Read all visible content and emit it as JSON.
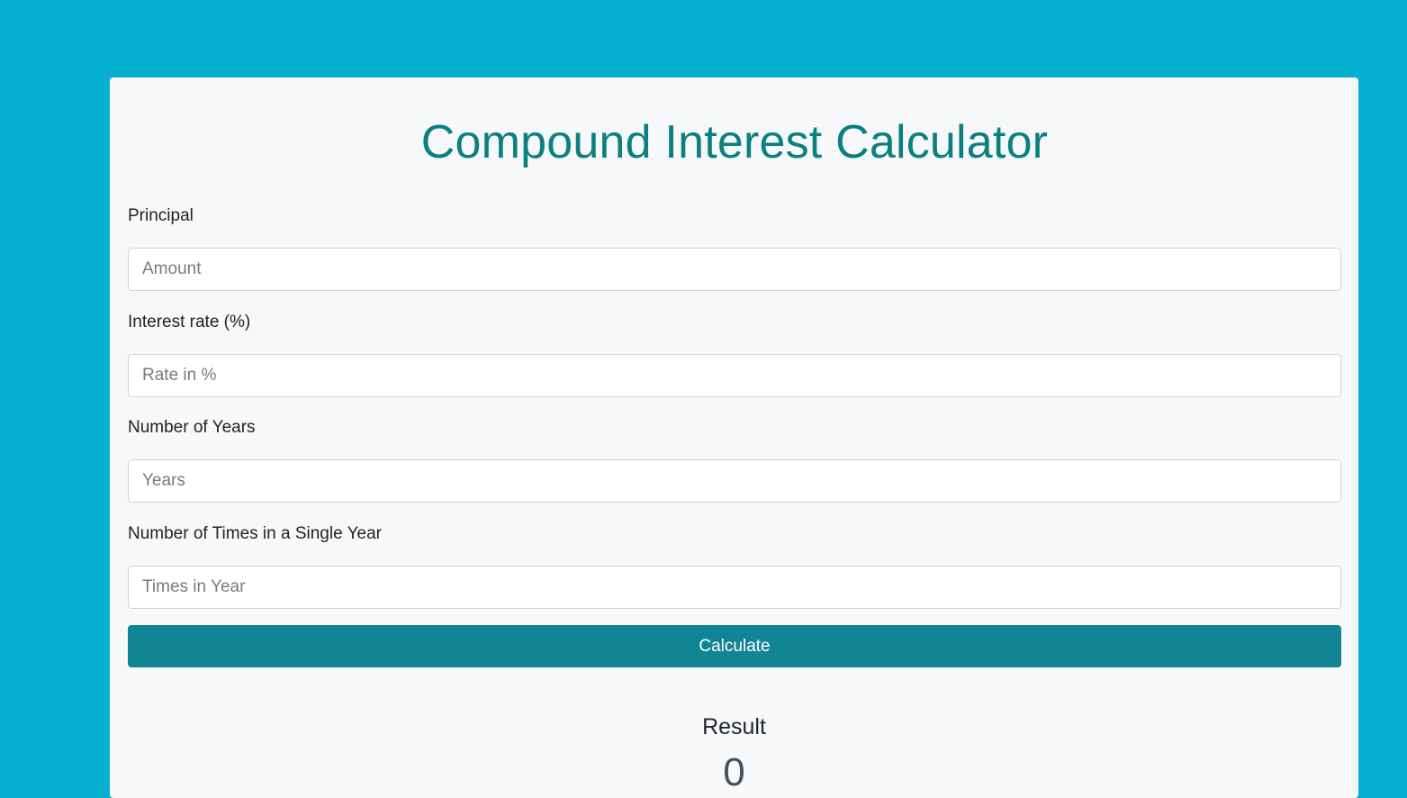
{
  "calculator": {
    "title": "Compound Interest Calculator",
    "fields": [
      {
        "label": "Principal",
        "placeholder": "Amount",
        "value": ""
      },
      {
        "label": "Interest rate (%)",
        "placeholder": "Rate in %",
        "value": ""
      },
      {
        "label": "Number of Years",
        "placeholder": "Years",
        "value": ""
      },
      {
        "label": "Number of Times in a Single Year",
        "placeholder": "Times in Year",
        "value": ""
      }
    ],
    "button_label": "Calculate",
    "result_label": "Result",
    "result_value": "0"
  },
  "colors": {
    "background": "#07b0cf",
    "title": "#0a8080",
    "button": "#128595",
    "card": "#f7f8f9"
  }
}
